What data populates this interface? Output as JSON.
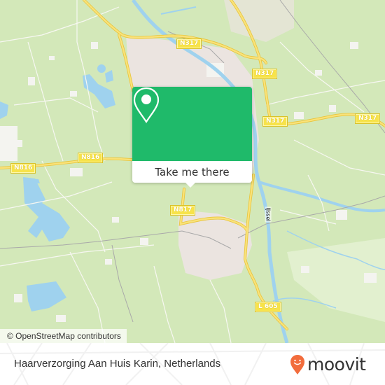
{
  "map": {
    "road_labels": [
      {
        "id": "n317-top",
        "text": "N317"
      },
      {
        "id": "n317-mid",
        "text": "N317"
      },
      {
        "id": "n317-center",
        "text": "N317"
      },
      {
        "id": "n317-right",
        "text": "N317"
      },
      {
        "id": "n816-left",
        "text": "N816"
      },
      {
        "id": "n816-center",
        "text": "N816"
      },
      {
        "id": "n817",
        "text": "N817"
      },
      {
        "id": "l605",
        "text": "L 605"
      }
    ],
    "river_label": "IJssel",
    "attribution": "© OpenStreetMap contributors",
    "colors": {
      "land": "#d3e8b9",
      "urban": "#ebe4e0",
      "water": "#9fd2ee",
      "road": "#f7d94f"
    }
  },
  "popup": {
    "action_label": "Take me there",
    "icon": "map-pin-icon",
    "color": "#1fba6a"
  },
  "footer": {
    "place_name": "Haarverzorging Aan Huis Karin, Netherlands",
    "brand": "moovit",
    "brand_icon": "moovit-smiley-pin-icon",
    "brand_color": "#f26c3c"
  }
}
